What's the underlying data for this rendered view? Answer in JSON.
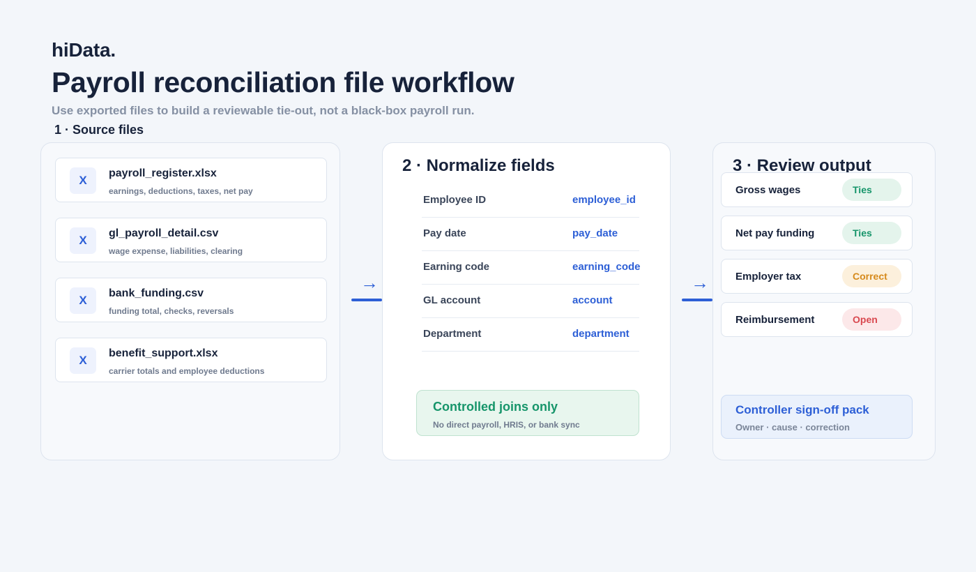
{
  "brand": "hiData.",
  "title": "Payroll reconciliation file workflow",
  "subtitle": "Use exported files to build a reviewable tie-out, not a black-box payroll run.",
  "steps": {
    "source": {
      "heading": "1 · Source files",
      "files": [
        {
          "icon": "excel-icon",
          "badge": "X",
          "name": "payroll_register.xlsx",
          "desc": "earnings, deductions, taxes, net pay"
        },
        {
          "icon": "excel-icon",
          "badge": "X",
          "name": "gl_payroll_detail.csv",
          "desc": "wage expense, liabilities, clearing"
        },
        {
          "icon": "excel-icon",
          "badge": "X",
          "name": "bank_funding.csv",
          "desc": "funding total, checks, reversals"
        },
        {
          "icon": "excel-icon",
          "badge": "X",
          "name": "benefit_support.xlsx",
          "desc": "carrier totals and employee deductions"
        }
      ]
    },
    "normalize": {
      "heading": "2 · Normalize fields",
      "mappings": [
        {
          "source": "Employee ID",
          "target": "employee_id"
        },
        {
          "source": "Pay date",
          "target": "pay_date"
        },
        {
          "source": "Earning code",
          "target": "earning_code"
        },
        {
          "source": "GL account",
          "target": "account"
        },
        {
          "source": "Department",
          "target": "department"
        }
      ],
      "callout": {
        "title": "Controlled joins only",
        "desc": "No direct payroll, HRIS, or bank sync"
      }
    },
    "review": {
      "heading": "3 · Review output",
      "checks": [
        {
          "label": "Gross wages",
          "status": "Ties",
          "status_color": "#16956a",
          "status_bg": "#e4f4ec"
        },
        {
          "label": "Net pay funding",
          "status": "Ties",
          "status_color": "#16956a",
          "status_bg": "#e4f4ec"
        },
        {
          "label": "Employer tax",
          "status": "Correct",
          "status_color": "#d68a1c",
          "status_bg": "#fcf0dc"
        },
        {
          "label": "Reimbursement",
          "status": "Open",
          "status_color": "#d9484f",
          "status_bg": "#fce8e9"
        }
      ],
      "signoff": {
        "title": "Controller sign-off pack",
        "desc": "Owner · cause · correction"
      }
    }
  },
  "connector_arrow": "→",
  "colors": {
    "accent": "#2d5fd6",
    "background": "#f3f6fa",
    "text": "#17223a",
    "success": "#16956a"
  }
}
